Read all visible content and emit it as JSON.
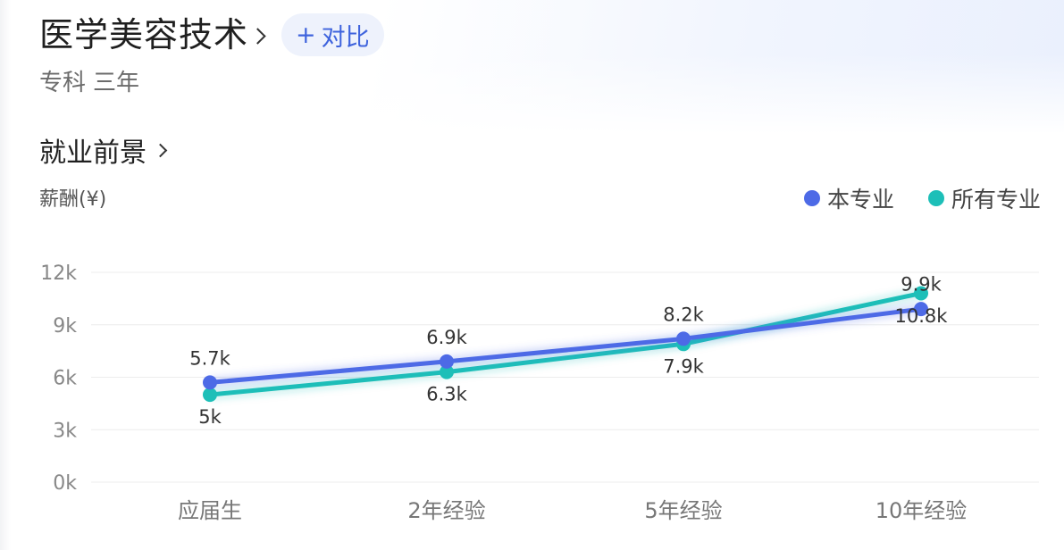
{
  "major": {
    "title": "医学美容技术",
    "compare_plus": "+",
    "compare_label": "对比",
    "level": "专科",
    "duration": "三年"
  },
  "section": {
    "title": "就业前景"
  },
  "colors": {
    "accent": "#3e63dd",
    "series_major": "#4d6ae6",
    "series_all": "#1dbfb8"
  },
  "icons": {
    "major_chevron": "chevron-right-icon",
    "section_chevron": "chevron-right-icon",
    "legend_marker": "dot-icon"
  },
  "chart_data": {
    "type": "line",
    "title": "",
    "ylabel": "薪酬(¥)",
    "xlabel": "",
    "categories": [
      "应届生",
      "2年经验",
      "5年经验",
      "10年经验"
    ],
    "y_ticks": [
      0,
      3000,
      6000,
      9000,
      12000
    ],
    "y_tick_labels": [
      "0k",
      "3k",
      "6k",
      "9k",
      "12k"
    ],
    "ylim": [
      0,
      12000
    ],
    "grid": true,
    "legend_position": "top-right",
    "series": [
      {
        "name": "本专业",
        "color": "#4d6ae6",
        "values": [
          5700,
          6900,
          8200,
          9900
        ],
        "labels": [
          "5.7k",
          "6.9k",
          "8.2k",
          "9.9k"
        ]
      },
      {
        "name": "所有专业",
        "color": "#1dbfb8",
        "values": [
          5000,
          6300,
          7900,
          10800
        ],
        "labels": [
          "5k",
          "6.3k",
          "7.9k",
          "10.8k"
        ]
      }
    ]
  }
}
